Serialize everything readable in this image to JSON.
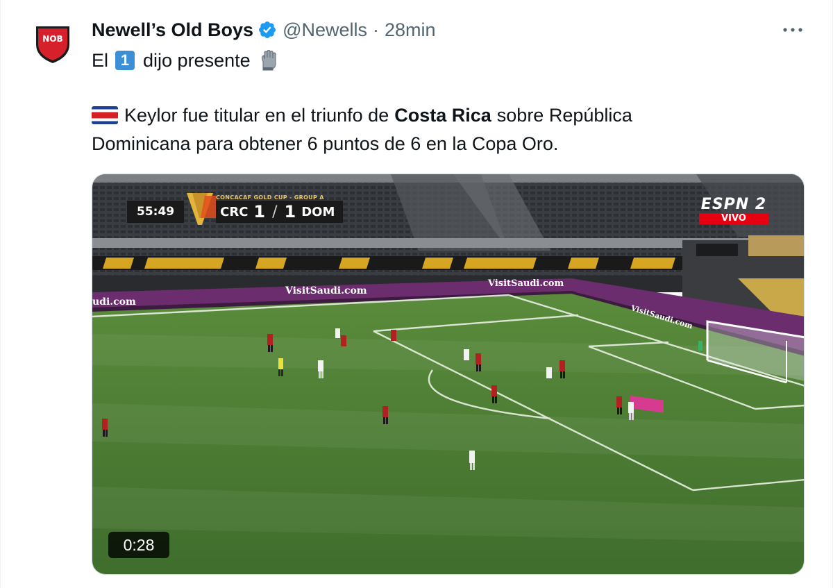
{
  "tweet": {
    "author_name": "Newell’s Old Boys",
    "handle": "@Newells",
    "separator": "·",
    "time": "28min",
    "line1_before": "El",
    "line1_keycap": "1",
    "line1_after": "dijo presente",
    "line3_before": "Keylor fue titular en el triunfo de",
    "line3_bold": "Costa Rica",
    "line3_after": "sobre República",
    "line4": "Dominicana para obtener 6 puntos de 6 en la Copa Oro."
  },
  "avatar": {
    "label": "NOB",
    "color": "#d6202b"
  },
  "icons": {
    "verified": "verified-badge-icon",
    "more": "more-options-icon",
    "glove": "goalkeeper-glove-emoji",
    "flag": "costa-rica-flag-emoji"
  },
  "video": {
    "duration": "0:28",
    "scoreboard": {
      "clock": "55:49",
      "tournament": "CONCACAF GOLD CUP - GROUP A",
      "home": "CRC",
      "home_score": "1",
      "separator": "/",
      "away_score": "1",
      "away": "DOM"
    },
    "broadcaster": {
      "name": "ESPN 2",
      "status": "VIVO"
    },
    "ads": [
      "udi.com",
      "VisitSaudi.com",
      "VisitSaudi.com",
      "VisitSaudi.com"
    ]
  },
  "colors": {
    "accent": "#1d9bf0",
    "pitch": "#4a7a35",
    "ad_board": "#6b2d6e"
  }
}
